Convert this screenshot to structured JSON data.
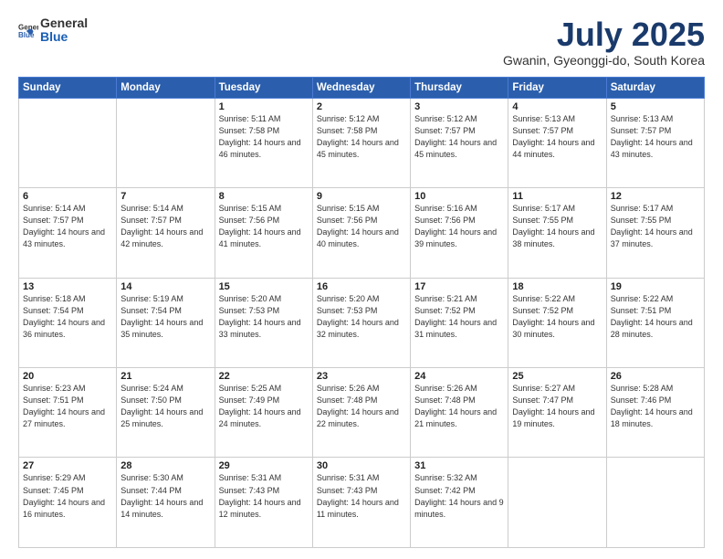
{
  "header": {
    "logo_general": "General",
    "logo_blue": "Blue",
    "month_title": "July 2025",
    "subtitle": "Gwanin, Gyeonggi-do, South Korea"
  },
  "weekdays": [
    "Sunday",
    "Monday",
    "Tuesday",
    "Wednesday",
    "Thursday",
    "Friday",
    "Saturday"
  ],
  "weeks": [
    [
      {
        "day": "",
        "sunrise": "",
        "sunset": "",
        "daylight": ""
      },
      {
        "day": "",
        "sunrise": "",
        "sunset": "",
        "daylight": ""
      },
      {
        "day": "1",
        "sunrise": "Sunrise: 5:11 AM",
        "sunset": "Sunset: 7:58 PM",
        "daylight": "Daylight: 14 hours and 46 minutes."
      },
      {
        "day": "2",
        "sunrise": "Sunrise: 5:12 AM",
        "sunset": "Sunset: 7:58 PM",
        "daylight": "Daylight: 14 hours and 45 minutes."
      },
      {
        "day": "3",
        "sunrise": "Sunrise: 5:12 AM",
        "sunset": "Sunset: 7:57 PM",
        "daylight": "Daylight: 14 hours and 45 minutes."
      },
      {
        "day": "4",
        "sunrise": "Sunrise: 5:13 AM",
        "sunset": "Sunset: 7:57 PM",
        "daylight": "Daylight: 14 hours and 44 minutes."
      },
      {
        "day": "5",
        "sunrise": "Sunrise: 5:13 AM",
        "sunset": "Sunset: 7:57 PM",
        "daylight": "Daylight: 14 hours and 43 minutes."
      }
    ],
    [
      {
        "day": "6",
        "sunrise": "Sunrise: 5:14 AM",
        "sunset": "Sunset: 7:57 PM",
        "daylight": "Daylight: 14 hours and 43 minutes."
      },
      {
        "day": "7",
        "sunrise": "Sunrise: 5:14 AM",
        "sunset": "Sunset: 7:57 PM",
        "daylight": "Daylight: 14 hours and 42 minutes."
      },
      {
        "day": "8",
        "sunrise": "Sunrise: 5:15 AM",
        "sunset": "Sunset: 7:56 PM",
        "daylight": "Daylight: 14 hours and 41 minutes."
      },
      {
        "day": "9",
        "sunrise": "Sunrise: 5:15 AM",
        "sunset": "Sunset: 7:56 PM",
        "daylight": "Daylight: 14 hours and 40 minutes."
      },
      {
        "day": "10",
        "sunrise": "Sunrise: 5:16 AM",
        "sunset": "Sunset: 7:56 PM",
        "daylight": "Daylight: 14 hours and 39 minutes."
      },
      {
        "day": "11",
        "sunrise": "Sunrise: 5:17 AM",
        "sunset": "Sunset: 7:55 PM",
        "daylight": "Daylight: 14 hours and 38 minutes."
      },
      {
        "day": "12",
        "sunrise": "Sunrise: 5:17 AM",
        "sunset": "Sunset: 7:55 PM",
        "daylight": "Daylight: 14 hours and 37 minutes."
      }
    ],
    [
      {
        "day": "13",
        "sunrise": "Sunrise: 5:18 AM",
        "sunset": "Sunset: 7:54 PM",
        "daylight": "Daylight: 14 hours and 36 minutes."
      },
      {
        "day": "14",
        "sunrise": "Sunrise: 5:19 AM",
        "sunset": "Sunset: 7:54 PM",
        "daylight": "Daylight: 14 hours and 35 minutes."
      },
      {
        "day": "15",
        "sunrise": "Sunrise: 5:20 AM",
        "sunset": "Sunset: 7:53 PM",
        "daylight": "Daylight: 14 hours and 33 minutes."
      },
      {
        "day": "16",
        "sunrise": "Sunrise: 5:20 AM",
        "sunset": "Sunset: 7:53 PM",
        "daylight": "Daylight: 14 hours and 32 minutes."
      },
      {
        "day": "17",
        "sunrise": "Sunrise: 5:21 AM",
        "sunset": "Sunset: 7:52 PM",
        "daylight": "Daylight: 14 hours and 31 minutes."
      },
      {
        "day": "18",
        "sunrise": "Sunrise: 5:22 AM",
        "sunset": "Sunset: 7:52 PM",
        "daylight": "Daylight: 14 hours and 30 minutes."
      },
      {
        "day": "19",
        "sunrise": "Sunrise: 5:22 AM",
        "sunset": "Sunset: 7:51 PM",
        "daylight": "Daylight: 14 hours and 28 minutes."
      }
    ],
    [
      {
        "day": "20",
        "sunrise": "Sunrise: 5:23 AM",
        "sunset": "Sunset: 7:51 PM",
        "daylight": "Daylight: 14 hours and 27 minutes."
      },
      {
        "day": "21",
        "sunrise": "Sunrise: 5:24 AM",
        "sunset": "Sunset: 7:50 PM",
        "daylight": "Daylight: 14 hours and 25 minutes."
      },
      {
        "day": "22",
        "sunrise": "Sunrise: 5:25 AM",
        "sunset": "Sunset: 7:49 PM",
        "daylight": "Daylight: 14 hours and 24 minutes."
      },
      {
        "day": "23",
        "sunrise": "Sunrise: 5:26 AM",
        "sunset": "Sunset: 7:48 PM",
        "daylight": "Daylight: 14 hours and 22 minutes."
      },
      {
        "day": "24",
        "sunrise": "Sunrise: 5:26 AM",
        "sunset": "Sunset: 7:48 PM",
        "daylight": "Daylight: 14 hours and 21 minutes."
      },
      {
        "day": "25",
        "sunrise": "Sunrise: 5:27 AM",
        "sunset": "Sunset: 7:47 PM",
        "daylight": "Daylight: 14 hours and 19 minutes."
      },
      {
        "day": "26",
        "sunrise": "Sunrise: 5:28 AM",
        "sunset": "Sunset: 7:46 PM",
        "daylight": "Daylight: 14 hours and 18 minutes."
      }
    ],
    [
      {
        "day": "27",
        "sunrise": "Sunrise: 5:29 AM",
        "sunset": "Sunset: 7:45 PM",
        "daylight": "Daylight: 14 hours and 16 minutes."
      },
      {
        "day": "28",
        "sunrise": "Sunrise: 5:30 AM",
        "sunset": "Sunset: 7:44 PM",
        "daylight": "Daylight: 14 hours and 14 minutes."
      },
      {
        "day": "29",
        "sunrise": "Sunrise: 5:31 AM",
        "sunset": "Sunset: 7:43 PM",
        "daylight": "Daylight: 14 hours and 12 minutes."
      },
      {
        "day": "30",
        "sunrise": "Sunrise: 5:31 AM",
        "sunset": "Sunset: 7:43 PM",
        "daylight": "Daylight: 14 hours and 11 minutes."
      },
      {
        "day": "31",
        "sunrise": "Sunrise: 5:32 AM",
        "sunset": "Sunset: 7:42 PM",
        "daylight": "Daylight: 14 hours and 9 minutes."
      },
      {
        "day": "",
        "sunrise": "",
        "sunset": "",
        "daylight": ""
      },
      {
        "day": "",
        "sunrise": "",
        "sunset": "",
        "daylight": ""
      }
    ]
  ]
}
